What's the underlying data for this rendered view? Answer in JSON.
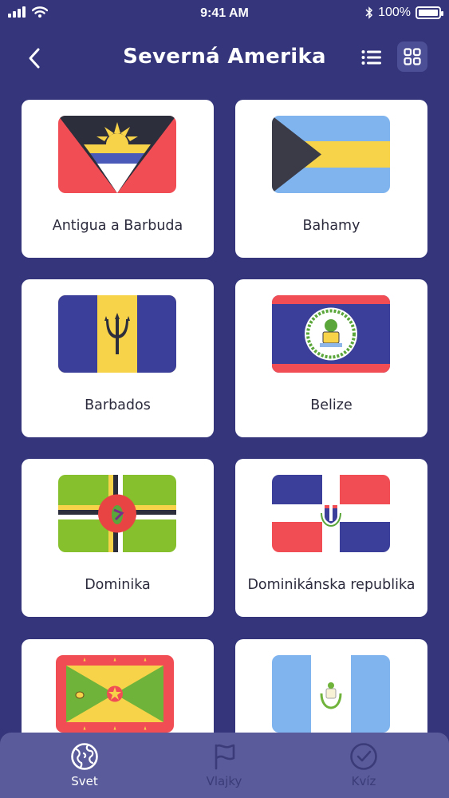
{
  "status_bar": {
    "time": "9:41 AM",
    "battery": "100%"
  },
  "header": {
    "title": "Severná Amerika"
  },
  "countries": [
    {
      "name": "Antigua a Barbuda",
      "flag": "antigua-and-barbuda-flag"
    },
    {
      "name": "Bahamy",
      "flag": "bahamas-flag"
    },
    {
      "name": "Barbados",
      "flag": "barbados-flag"
    },
    {
      "name": "Belize",
      "flag": "belize-flag"
    },
    {
      "name": "Dominika",
      "flag": "dominica-flag"
    },
    {
      "name": "Dominikánska republika",
      "flag": "dominican-republic-flag"
    },
    {
      "name": "",
      "flag": "grenada-flag"
    },
    {
      "name": "",
      "flag": "guatemala-flag"
    }
  ],
  "tabs": [
    {
      "label": "Svet",
      "icon": "globe-icon",
      "active": true
    },
    {
      "label": "Vlajky",
      "icon": "flag-icon",
      "active": false
    },
    {
      "label": "Kvíz",
      "icon": "check-circle-icon",
      "active": false
    }
  ],
  "colors": {
    "background": "#34357a",
    "tabbar": "#5a5b9a",
    "card": "#ffffff"
  }
}
